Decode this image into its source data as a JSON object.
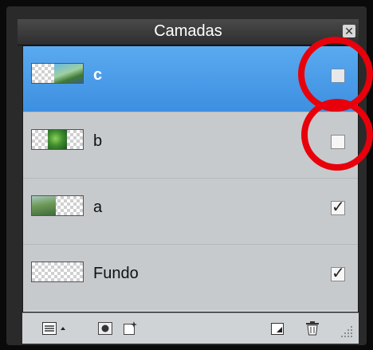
{
  "panel": {
    "title": "Camadas",
    "close_icon": "close-icon"
  },
  "layers": [
    {
      "name": "c",
      "visible": false,
      "selected": true,
      "thumbnail": "landscape-thumbnail-right"
    },
    {
      "name": "b",
      "visible": false,
      "selected": false,
      "thumbnail": "foliage-thumbnail-center"
    },
    {
      "name": "a",
      "visible": true,
      "selected": false,
      "thumbnail": "landscape-thumbnail-left"
    },
    {
      "name": "Fundo",
      "visible": true,
      "selected": false,
      "thumbnail": "transparent-thumbnail"
    }
  ],
  "toolbar": {
    "icons": [
      "layer-options-icon",
      "dropdown-arrow-icon",
      "layer-mask-icon",
      "layer-effects-icon",
      "new-layer-icon",
      "trash-icon",
      "resize-grip-icon"
    ]
  },
  "colors": {
    "selection": "#4a9ae8",
    "highlight_ring": "#e8000b",
    "panel_bg": "#d0d3d6"
  },
  "checkmark_glyph": "✓",
  "annotations": [
    "red-circle-highlight",
    "red-circle-highlight"
  ]
}
